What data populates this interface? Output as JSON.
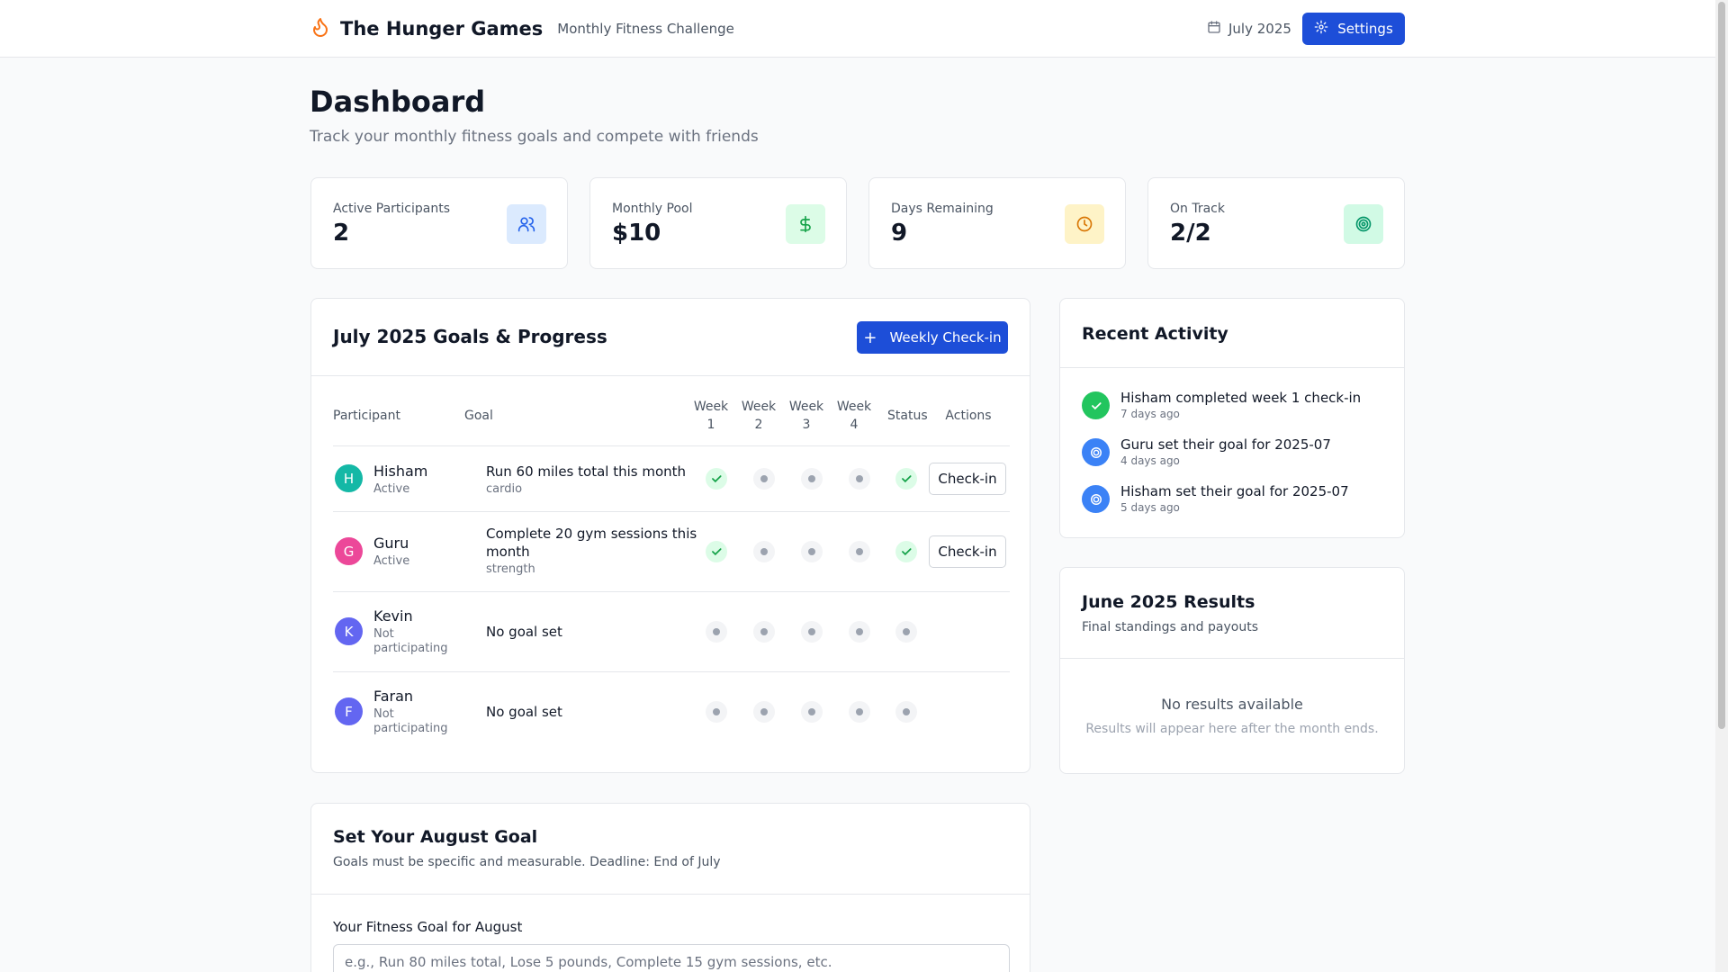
{
  "header": {
    "app_title": "The Hunger Games",
    "app_subtitle": "Monthly Fitness Challenge",
    "month": "July 2025",
    "settings_label": "Settings",
    "icons": [
      "flame-icon",
      "calendar-icon",
      "gear-icon"
    ]
  },
  "page": {
    "title": "Dashboard",
    "subtitle": "Track your monthly fitness goals and compete with friends"
  },
  "stats": [
    {
      "label": "Active Participants",
      "value": "2",
      "icon": "users-icon",
      "bg": "#dbeafe",
      "color": "#2563eb"
    },
    {
      "label": "Monthly Pool",
      "value": "$10",
      "icon": "dollar-icon",
      "bg": "#dcfce7",
      "color": "#16a34a"
    },
    {
      "label": "Days Remaining",
      "value": "9",
      "icon": "clock-icon",
      "bg": "#fef3c7",
      "color": "#d97706"
    },
    {
      "label": "On Track",
      "value": "2/2",
      "icon": "target-icon",
      "bg": "#d1fae5",
      "color": "#059669"
    }
  ],
  "goals": {
    "title": "July 2025 Goals & Progress",
    "checkin_label": "Weekly Check-in",
    "columns": {
      "participant": "Participant",
      "goal": "Goal",
      "week1": "Week 1",
      "week2": "Week 2",
      "week3": "Week 3",
      "week4": "Week 4",
      "status": "Status",
      "actions": "Actions"
    },
    "rows": [
      {
        "initial": "H",
        "name": "Hisham",
        "status": "Active",
        "goal": "Run 60 miles total this month",
        "category": "cardio",
        "avatar_color": "#14b8a6",
        "weeks": [
          "done",
          "pending",
          "pending",
          "pending"
        ],
        "status_mark": "done",
        "action": "Check-in"
      },
      {
        "initial": "G",
        "name": "Guru",
        "status": "Active",
        "goal": "Complete 20 gym sessions this month",
        "category": "strength",
        "avatar_color": "#ec4899",
        "weeks": [
          "done",
          "pending",
          "pending",
          "pending"
        ],
        "status_mark": "done",
        "action": "Check-in"
      },
      {
        "initial": "K",
        "name": "Kevin",
        "status": "Not participating",
        "goal": "No goal set",
        "category": "",
        "avatar_color": "#6366f1",
        "weeks": [
          "pending",
          "pending",
          "pending",
          "pending"
        ],
        "status_mark": "pending",
        "action": ""
      },
      {
        "initial": "F",
        "name": "Faran",
        "status": "Not participating",
        "goal": "No goal set",
        "category": "",
        "avatar_color": "#6366f1",
        "weeks": [
          "pending",
          "pending",
          "pending",
          "pending"
        ],
        "status_mark": "pending",
        "action": ""
      }
    ]
  },
  "activity": {
    "title": "Recent Activity",
    "items": [
      {
        "text": "Hisham completed week 1 check-in",
        "time": "7 days ago",
        "icon": "check-icon",
        "color": "#22c55e"
      },
      {
        "text": "Guru set their goal for 2025-07",
        "time": "4 days ago",
        "icon": "target-icon",
        "color": "#3b82f6"
      },
      {
        "text": "Hisham set their goal for 2025-07",
        "time": "5 days ago",
        "icon": "target-icon",
        "color": "#3b82f6"
      }
    ]
  },
  "results": {
    "title": "June 2025 Results",
    "subtitle": "Final standings and payouts",
    "empty_title": "No results available",
    "empty_sub": "Results will appear here after the month ends."
  },
  "august": {
    "title": "Set Your August Goal",
    "subtitle": "Goals must be specific and measurable. Deadline: End of July",
    "field_label": "Your Fitness Goal for August",
    "placeholder": "e.g., Run 80 miles total, Lose 5 pounds, Complete 15 gym sessions, etc.",
    "value": ""
  }
}
